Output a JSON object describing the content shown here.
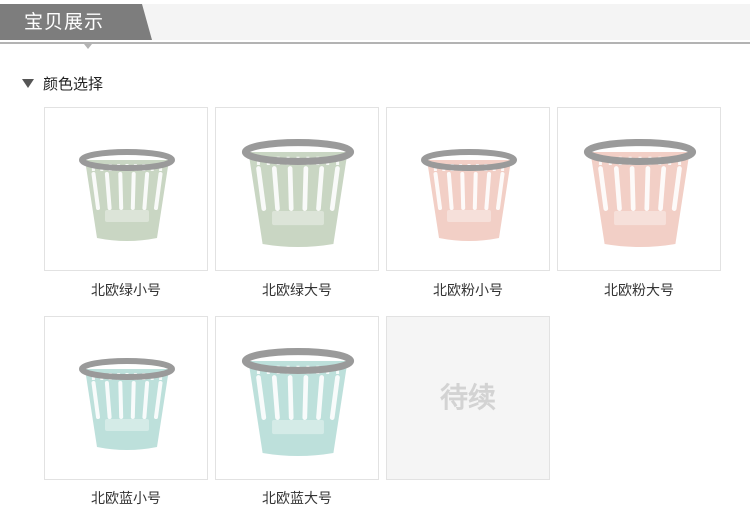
{
  "header": {
    "title": "宝贝展示"
  },
  "section": {
    "label": "颜色选择"
  },
  "products": [
    {
      "name": "北欧绿小号",
      "color": "green",
      "size": "small"
    },
    {
      "name": "北欧绿大号",
      "color": "green",
      "size": "large"
    },
    {
      "name": "北欧粉小号",
      "color": "pink",
      "size": "small"
    },
    {
      "name": "北欧粉大号",
      "color": "pink",
      "size": "large"
    },
    {
      "name": "北欧蓝小号",
      "color": "blue",
      "size": "small"
    },
    {
      "name": "北欧蓝大号",
      "color": "blue",
      "size": "large"
    }
  ],
  "placeholder": {
    "label": "待续"
  },
  "colors": {
    "green": "#c9d6c3",
    "pink": "#f2cfc6",
    "blue": "#bde0db",
    "rim": "#9a9a9a",
    "header_tab": "#7d7d7d"
  },
  "icons": {
    "section_marker": "triangle-down-icon",
    "product_image": "trash-bin-icon"
  }
}
